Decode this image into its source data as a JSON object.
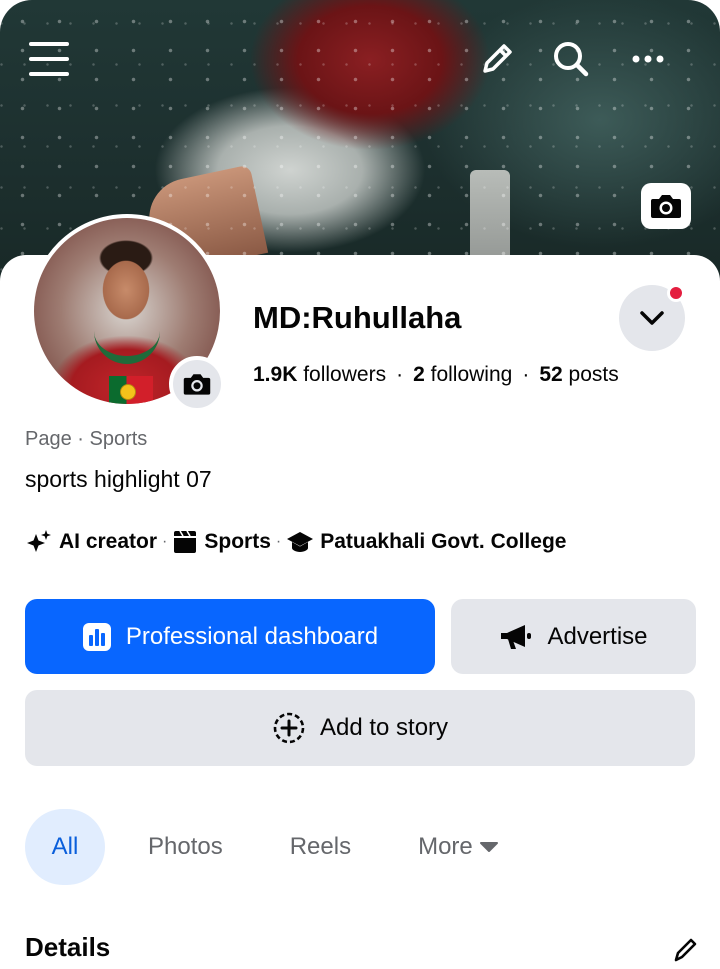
{
  "profile": {
    "name": "MD:Ruhullaha",
    "followers_count": "1.9K",
    "followers_label": "followers",
    "following_count": "2",
    "following_label": "following",
    "posts_count": "52",
    "posts_label": "posts",
    "separator": "·"
  },
  "page_meta": {
    "category": "Page · Sports",
    "bio": "sports highlight 07"
  },
  "details_row": [
    {
      "label": "AI creator",
      "icon": "sparkle-icon"
    },
    {
      "label": "Sports",
      "icon": "clapperboard-icon"
    },
    {
      "label": "Patuakhali Govt. College",
      "icon": "graduation-cap-icon"
    }
  ],
  "actions": {
    "professional_dashboard": "Professional dashboard",
    "advertise": "Advertise",
    "add_to_story": "Add to story"
  },
  "tabs": [
    {
      "label": "All",
      "active": true
    },
    {
      "label": "Photos",
      "active": false
    },
    {
      "label": "Reels",
      "active": false
    },
    {
      "label": "More",
      "active": false
    }
  ],
  "section": {
    "details_heading": "Details"
  },
  "icons": {
    "menu": "hamburger-menu-icon",
    "edit": "pencil-icon",
    "search": "search-icon",
    "more": "more-dots-icon",
    "cover_camera": "camera-icon",
    "avatar_camera": "camera-icon",
    "dropdown": "chevron-down-icon"
  },
  "colors": {
    "primary_blue": "#0866ff",
    "button_gray": "#e4e6eb",
    "active_tab_bg": "#e1edfe",
    "active_tab_text": "#0a5fdb",
    "notification_red": "#e41e3f",
    "secondary_text": "#65676b"
  }
}
